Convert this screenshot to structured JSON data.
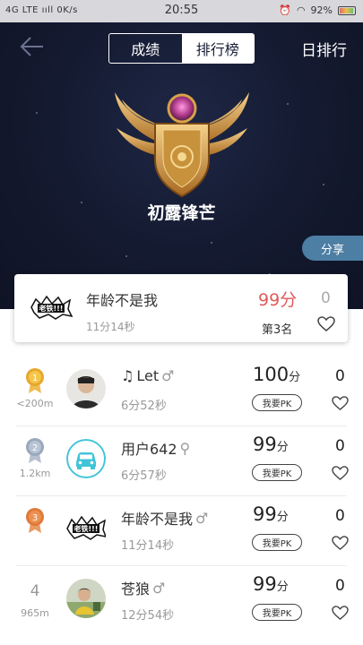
{
  "status_bar": {
    "left": "4G LTE ııll  0K/s",
    "time": "20:55",
    "battery": "92%"
  },
  "header": {
    "tabs": [
      {
        "label": "成绩",
        "active": false
      },
      {
        "label": "排行榜",
        "active": true
      }
    ],
    "right_label": "日排行",
    "level_title": "初露锋芒",
    "share_label": "分享"
  },
  "my_card": {
    "name": "年龄不是我",
    "time": "11分14秒",
    "score": "99分",
    "rank": "第3名",
    "likes": "0"
  },
  "ranking": [
    {
      "rank": "1",
      "distance": "<200m",
      "name": "Let",
      "prefix_icon": "music-note-icon",
      "gender": "♂",
      "time": "6分52秒",
      "score": "100",
      "unit": "分",
      "pk": "我要PK",
      "likes": "0"
    },
    {
      "rank": "2",
      "distance": "1.2km",
      "name": "用户642",
      "gender": "⚲",
      "time": "6分57秒",
      "score": "99",
      "unit": "分",
      "pk": "我要PK",
      "likes": "0"
    },
    {
      "rank": "3",
      "distance": "",
      "name": "年龄不是我",
      "gender": "♂",
      "time": "11分14秒",
      "score": "99",
      "unit": "分",
      "pk": "我要PK",
      "likes": "0"
    },
    {
      "rank": "4",
      "distance": "965m",
      "name": "苍狼",
      "gender": "♂",
      "time": "12分54秒",
      "score": "99",
      "unit": "分",
      "pk": "我要PK",
      "likes": "0"
    }
  ],
  "colors": {
    "hero_bg": "#141a30",
    "score_red": "#e15a5a",
    "share_bg": "#4d7ea3",
    "gold": "#e6a72e",
    "silver": "#9aa8bd",
    "bronze": "#e07a3a",
    "car_avatar": "#40c4d8"
  }
}
